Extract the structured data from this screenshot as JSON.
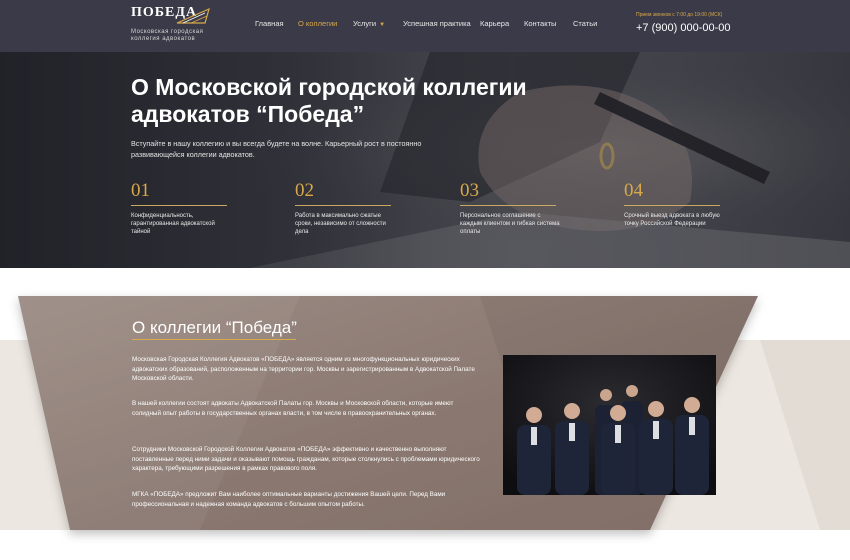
{
  "header": {
    "logo_text": "ПОБЕДА",
    "logo_sub": "Московская городская коллегия адвокатов",
    "nav": [
      {
        "label": "Главная"
      },
      {
        "label": "О коллегии",
        "active": true
      },
      {
        "label": "Услуги",
        "has_dropdown": true
      },
      {
        "label": "Успешная практика"
      },
      {
        "label": "Карьера"
      },
      {
        "label": "Контакты"
      },
      {
        "label": "Статьи"
      }
    ],
    "hours": "Прием звонков с 7:00 до 19:00 (МСК)",
    "phone": "+7 (900) 000-00-00",
    "icons": {
      "dropdown": "chevron-down-icon",
      "logo": "logo-mark-icon"
    }
  },
  "hero": {
    "title": "О Московской городской коллегии адвокатов “Победа”",
    "subtitle": "Вступайте в нашу коллегию и вы всегда будете на волне. Карьерный рост в постоянно развивающейся коллегии адвокатов.",
    "features": [
      {
        "num": "01",
        "text": "Конфиденциальность, гарантированная адвокатской тайной"
      },
      {
        "num": "02",
        "text": "Работа в максимально сжатые сроки, независимо от сложности дела"
      },
      {
        "num": "03",
        "text": "Персональное соглашение с каждым клиентом и гибкая система оплаты"
      },
      {
        "num": "04",
        "text": "Срочный выезд адвоката в любую точку Российской Федерации"
      }
    ]
  },
  "about": {
    "title": "О коллегии “Победа”",
    "paragraphs": [
      "Московская Городская Коллегия Адвокатов «ПОБЕДА» является одним из многофункциональных юридических адвокатских образований, расположенным на территории гор. Москвы и зарегистрированным в Адвокатской Палате Московской области.",
      "В нашей коллегии состоят адвокаты Адвокатской Палаты гор. Москвы и Московской области, которые имеют солидный опыт работы в государственных органах власти, в том числе в правоохранительных органах.",
      "Сотрудники Московской Городской Коллегии Адвокатов «ПОБЕДА» эффективно и качественно выполняют поставленные перед ними задачи и оказывают помощь гражданам, которые столкнулись с проблемами юридического характера, требующими разрешения в рамках правового поля.",
      "МГКА «ПОБЕДА» предложит Вам наиболее оптимальные варианты достижения Вашей цели. Перед Вами профессиональная и надежная команда адвокатов с большим опытом работы."
    ]
  },
  "colors": {
    "header_bg": "#3a3a48",
    "accent_gold": "#d8a94a",
    "card_bg": "#8c7a72",
    "band_bg": "#ede7e1"
  }
}
